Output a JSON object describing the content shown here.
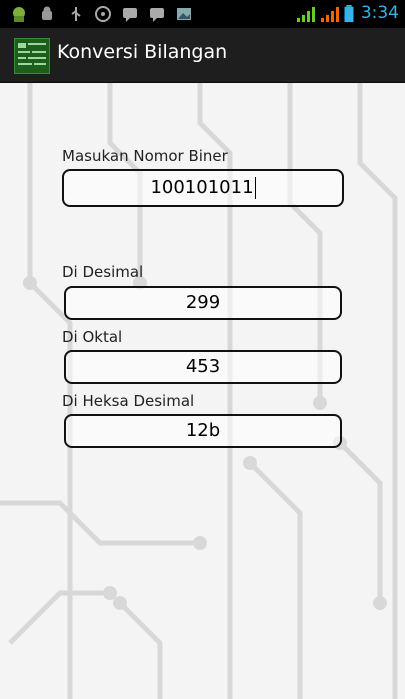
{
  "status_bar": {
    "time": "3:34",
    "icons": [
      "android-debug-icon",
      "android-icon",
      "usb-icon",
      "media-icon",
      "chat-icon",
      "chat-icon-2",
      "image-icon",
      "signal-icon",
      "signal-icon-2",
      "battery-icon"
    ],
    "accent": "#33b5e5"
  },
  "action_bar": {
    "title": "Konversi Bilangan",
    "icon": "app-icon"
  },
  "form": {
    "binary_label": "Masukan Nomor Biner",
    "binary_value": "100101011",
    "decimal_label": "Di Desimal",
    "decimal_value": "299",
    "octal_label": "Di Oktal",
    "octal_value": "453",
    "hex_label": "Di Heksa Desimal",
    "hex_value": "12b"
  }
}
